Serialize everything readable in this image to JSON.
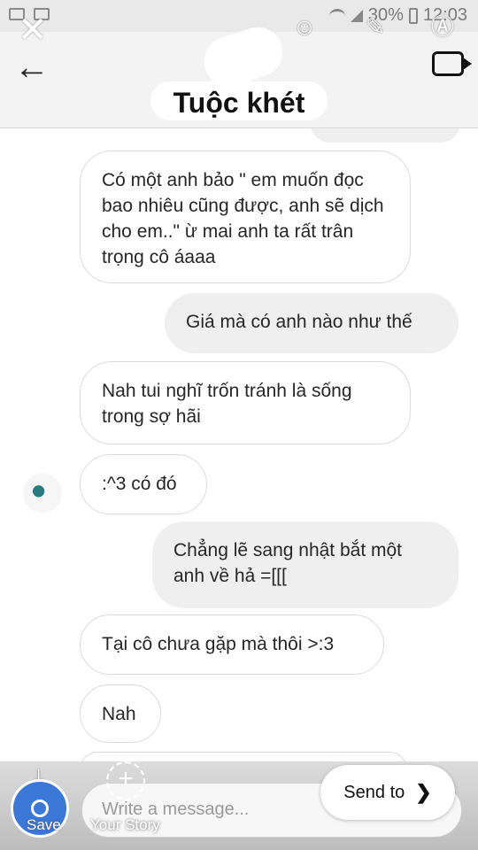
{
  "status_bar": {
    "battery": "30%",
    "time": "12:03"
  },
  "header": {
    "title": "Tuộc khét"
  },
  "messages": [
    {
      "side": "in",
      "text": "Có một anh bảo \" em muốn đọc bao nhiêu cũng được, anh sẽ dịch cho em..\"  ừ mai anh ta rất trân trọng cô áaaa"
    },
    {
      "side": "out",
      "text": "Giá mà có anh nào như thế"
    },
    {
      "side": "in",
      "text": "Nah tui nghĩ trốn tránh là sống trong sợ hãi"
    },
    {
      "side": "in",
      "text": ":^3 có đó"
    },
    {
      "side": "out",
      "text": "Chẳng lẽ sang nhật bắt một anh về hả =[[["
    },
    {
      "side": "in",
      "text": "Tại cô chưa gặp mà thôi >:3"
    },
    {
      "side": "in",
      "text": "Nah"
    }
  ],
  "composer": {
    "placeholder": "Write a message...",
    "save_label": "Save",
    "story_label": "Your Story",
    "send_label": "Send to"
  },
  "icons": [
    "back-arrow-icon",
    "video-call-icon",
    "close-icon",
    "sticker-icon",
    "pen-icon",
    "text-icon",
    "download-icon",
    "add-story-icon",
    "chevron-right-icon"
  ]
}
